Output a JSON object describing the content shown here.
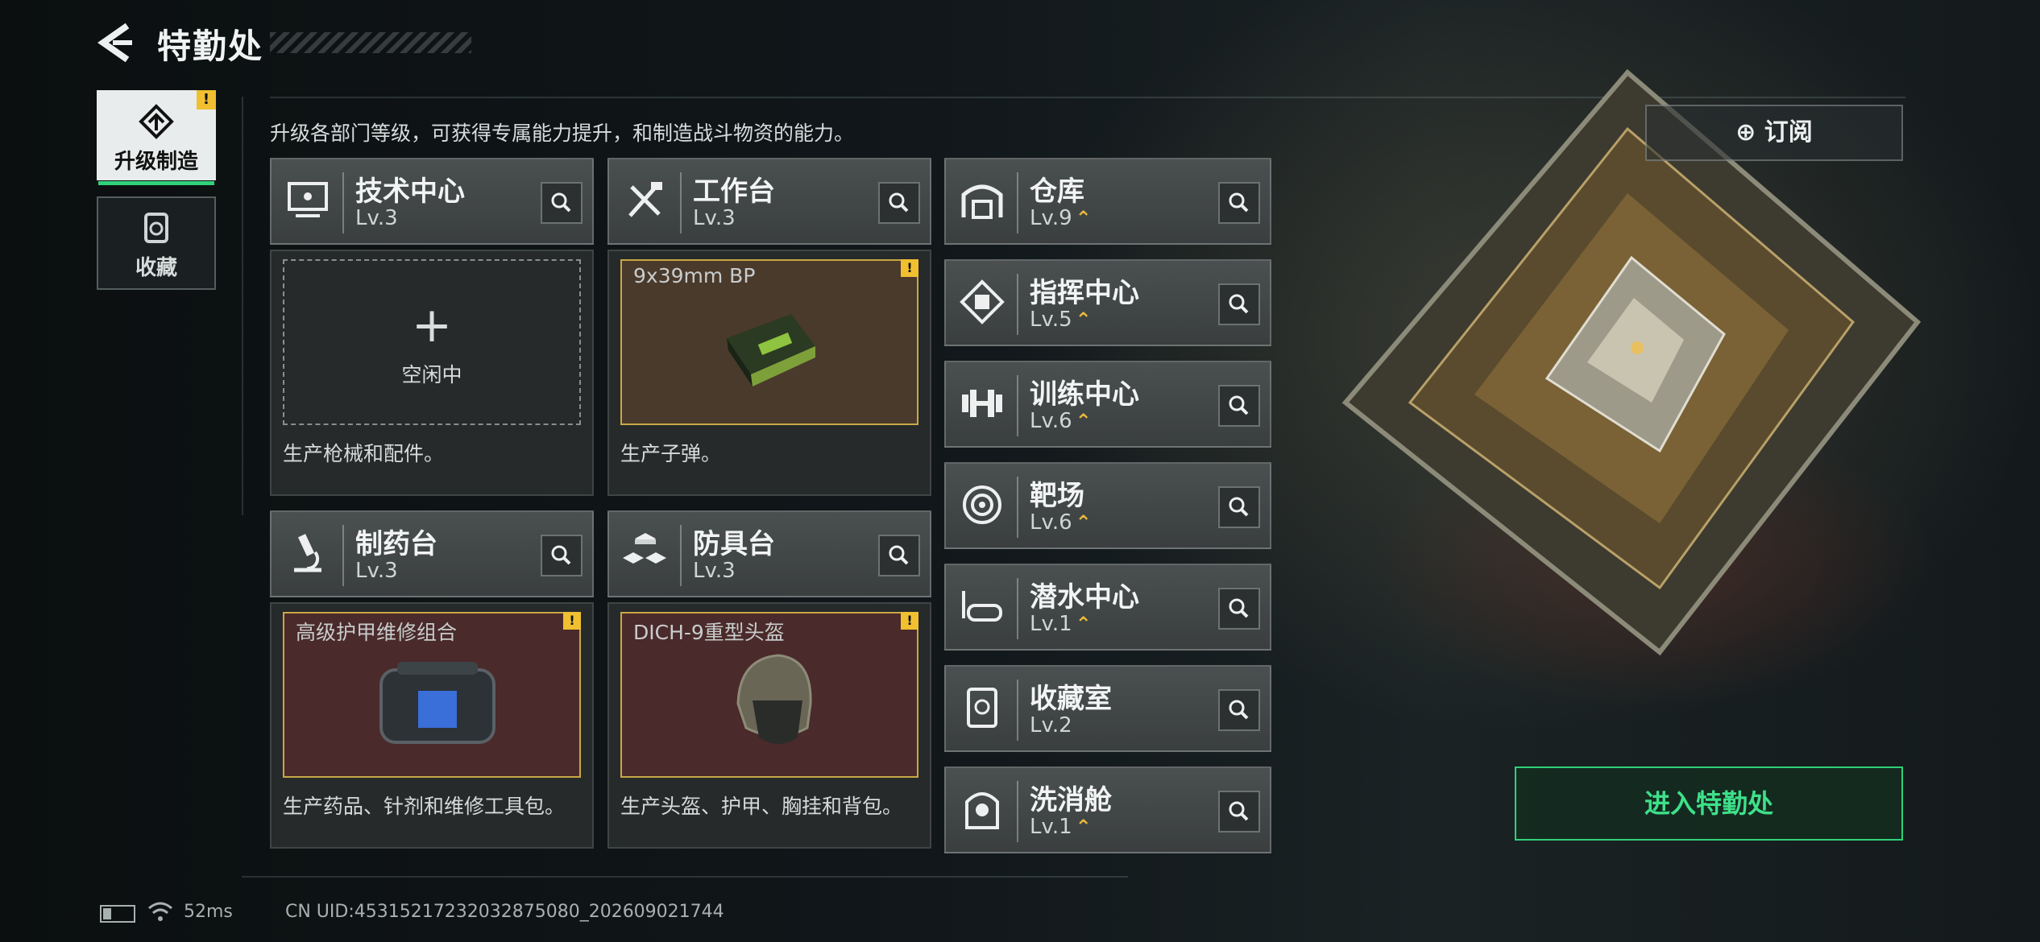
{
  "header": {
    "title": "特勤处"
  },
  "side_tabs": [
    {
      "label": "升级制造",
      "active": true,
      "warning": "!"
    },
    {
      "label": "收藏",
      "active": false
    }
  ],
  "description": "升级各部门等级，可获得专属能力提升，和制造战斗物资的能力。",
  "subscribe_label": "订阅",
  "enter_label": "进入特勤处",
  "workshops": [
    {
      "name": "技术中心",
      "level": "Lv.3",
      "slot": {
        "state": "empty",
        "idle_label": "空闲中"
      },
      "desc": "生产枪械和配件。"
    },
    {
      "name": "工作台",
      "level": "Lv.3",
      "slot": {
        "item": "9x39mm BP",
        "warning": "!"
      },
      "desc": "生产子弹。"
    },
    {
      "name": "制药台",
      "level": "Lv.3",
      "slot": {
        "item": "高级护甲维修组合",
        "warning": "!"
      },
      "desc": "生产药品、针剂和维修工具包。"
    },
    {
      "name": "防具台",
      "level": "Lv.3",
      "slot": {
        "item": "DICH-9重型头盔",
        "warning": "!"
      },
      "desc": "生产头盔、护甲、胸挂和背包。"
    }
  ],
  "facilities": [
    {
      "name": "仓库",
      "level": "Lv.9",
      "upgradable": true
    },
    {
      "name": "指挥中心",
      "level": "Lv.5",
      "upgradable": true
    },
    {
      "name": "训练中心",
      "level": "Lv.6",
      "upgradable": true
    },
    {
      "name": "靶场",
      "level": "Lv.6",
      "upgradable": true
    },
    {
      "name": "潜水中心",
      "level": "Lv.1",
      "upgradable": true
    },
    {
      "name": "收藏室",
      "level": "Lv.2",
      "upgradable": false
    },
    {
      "name": "洗消舱",
      "level": "Lv.1",
      "upgradable": true
    }
  ],
  "status_bar": {
    "ping": "52ms",
    "uid": "CN UID:453152172320328750​80_202609021744"
  },
  "colors": {
    "accent_green": "#2fd17a",
    "warning_yellow": "#f0c030",
    "upgrade_chevron": "#e7b93b"
  }
}
